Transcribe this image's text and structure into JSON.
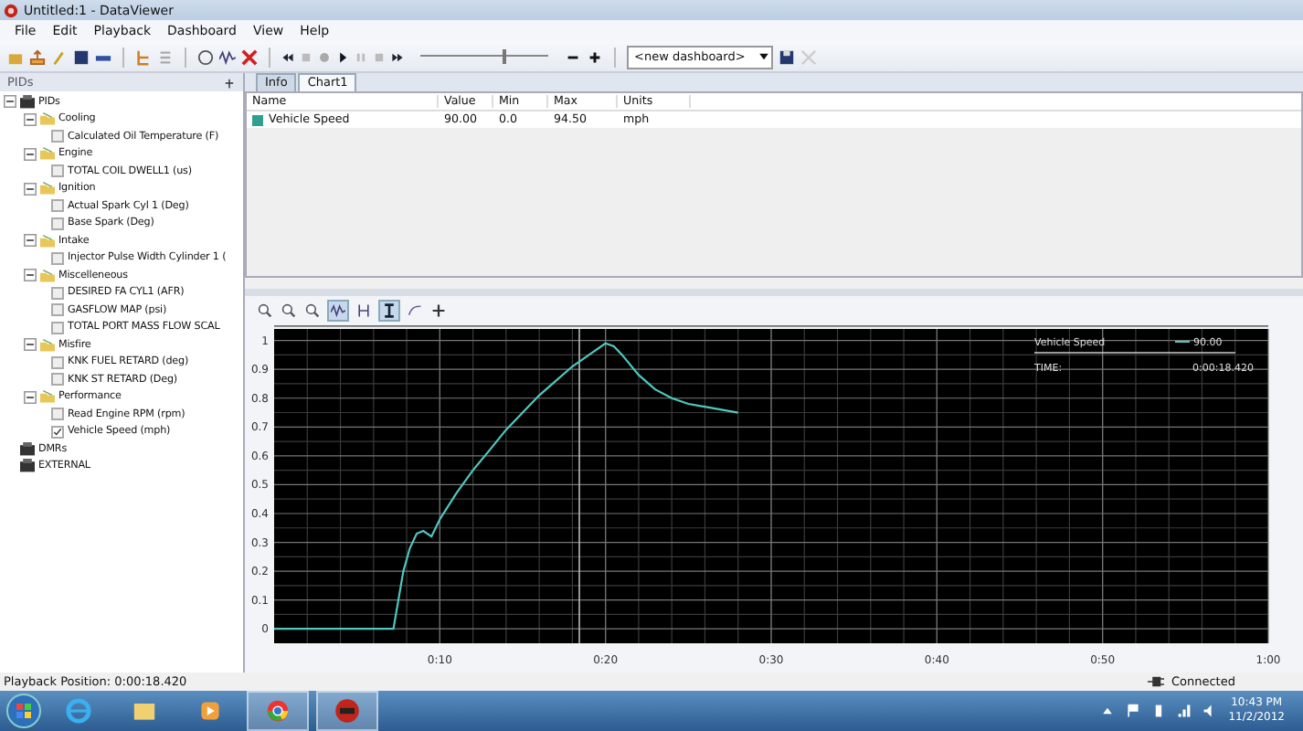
{
  "window": {
    "title": "Untitled:1 - DataViewer"
  },
  "menu": [
    "File",
    "Edit",
    "Playback",
    "Dashboard",
    "View",
    "Help"
  ],
  "toolbar": {
    "playback_slider": {
      "level": 0.65
    },
    "dashboard": {
      "value": "<new dashboard>"
    }
  },
  "side_panel": {
    "title": "PIDs",
    "tree": [
      {
        "label": "PIDs",
        "expanded": true,
        "children": [
          {
            "label": "Cooling",
            "expanded": true,
            "children": [
              {
                "label": "Calculated Oil Temperature (F)",
                "checked": false
              }
            ]
          },
          {
            "label": "Engine",
            "expanded": true,
            "children": [
              {
                "label": "TOTAL COIL DWELL1 (us)",
                "checked": false
              }
            ]
          },
          {
            "label": "Ignition",
            "expanded": true,
            "children": [
              {
                "label": "Actual Spark Cyl 1 (Deg)",
                "checked": false
              },
              {
                "label": "Base Spark (Deg)",
                "checked": false
              }
            ]
          },
          {
            "label": "Intake",
            "expanded": true,
            "children": [
              {
                "label": "Injector Pulse Width Cylinder 1 (",
                "checked": false
              }
            ]
          },
          {
            "label": "Miscelleneous",
            "expanded": true,
            "children": [
              {
                "label": "DESIRED FA CYL1 (AFR)",
                "checked": false
              },
              {
                "label": "GASFLOW MAP (psi)",
                "checked": false
              },
              {
                "label": "TOTAL PORT MASS FLOW SCAL",
                "checked": false
              }
            ]
          },
          {
            "label": "Misfire",
            "expanded": true,
            "children": [
              {
                "label": "KNK FUEL RETARD (deg)",
                "checked": false
              },
              {
                "label": "KNK ST RETARD (Deg)",
                "checked": false
              }
            ]
          },
          {
            "label": "Performance",
            "expanded": true,
            "children": [
              {
                "label": "Read Engine RPM (rpm)",
                "checked": false
              },
              {
                "label": "Vehicle Speed (mph)",
                "checked": true
              }
            ]
          }
        ]
      },
      {
        "label": "DMRs",
        "expanded": false
      },
      {
        "label": "EXTERNAL",
        "expanded": false
      }
    ]
  },
  "tabs": [
    {
      "label": "Info",
      "selected": false
    },
    {
      "label": "Chart1",
      "selected": true
    }
  ],
  "table": {
    "columns": [
      "Name",
      "Value",
      "Min",
      "Max",
      "Units"
    ],
    "rows": [
      {
        "color": "#2fa08f",
        "cells": [
          "Vehicle Speed",
          "90.00",
          "0.0",
          "94.50",
          "mph"
        ]
      }
    ]
  },
  "chart": {
    "legend": {
      "value": "90.00",
      "time_label": "TIME:",
      "time": "0:00:18.420"
    },
    "chart_data": {
      "type": "line",
      "x": [
        0,
        7.2,
        7.5,
        7.8,
        8.2,
        8.6,
        9.0,
        9.5,
        10,
        11,
        12,
        13,
        14,
        15,
        16,
        17,
        18,
        19,
        20,
        20.5,
        21,
        22,
        23,
        24,
        25,
        26,
        27,
        28
      ],
      "series": [
        {
          "name": "Vehicle Speed",
          "color": "#4fc8c0",
          "values": [
            0,
            0,
            0.1,
            0.2,
            0.28,
            0.33,
            0.34,
            0.32,
            0.38,
            0.47,
            0.55,
            0.62,
            0.69,
            0.75,
            0.81,
            0.86,
            0.91,
            0.95,
            0.99,
            0.98,
            0.95,
            0.88,
            0.83,
            0.8,
            0.78,
            0.77,
            0.76,
            0.75
          ]
        }
      ],
      "xlim": [
        0,
        60
      ],
      "ylim": [
        -0.05,
        1.04
      ],
      "xticks": [
        {
          "value": 10,
          "label": "0:10"
        },
        {
          "value": 20,
          "label": "0:20"
        },
        {
          "value": 30,
          "label": "0:30"
        },
        {
          "value": 40,
          "label": "0:40"
        },
        {
          "value": 50,
          "label": "0:50"
        },
        {
          "value": 60,
          "label": "1:00"
        }
      ],
      "yticks": [
        0,
        0.1,
        0.2,
        0.3,
        0.4,
        0.5,
        0.6,
        0.7,
        0.8,
        0.9,
        1
      ],
      "grid": true,
      "ref_lines": [
        {
          "axis": "x",
          "value": 18.42
        }
      ]
    }
  },
  "status_bar": {
    "position": "Playback Position: 0:00:18.420",
    "connection": "Connected"
  },
  "taskbar": {
    "time": "10:43 PM",
    "date": "11/2/2012"
  }
}
